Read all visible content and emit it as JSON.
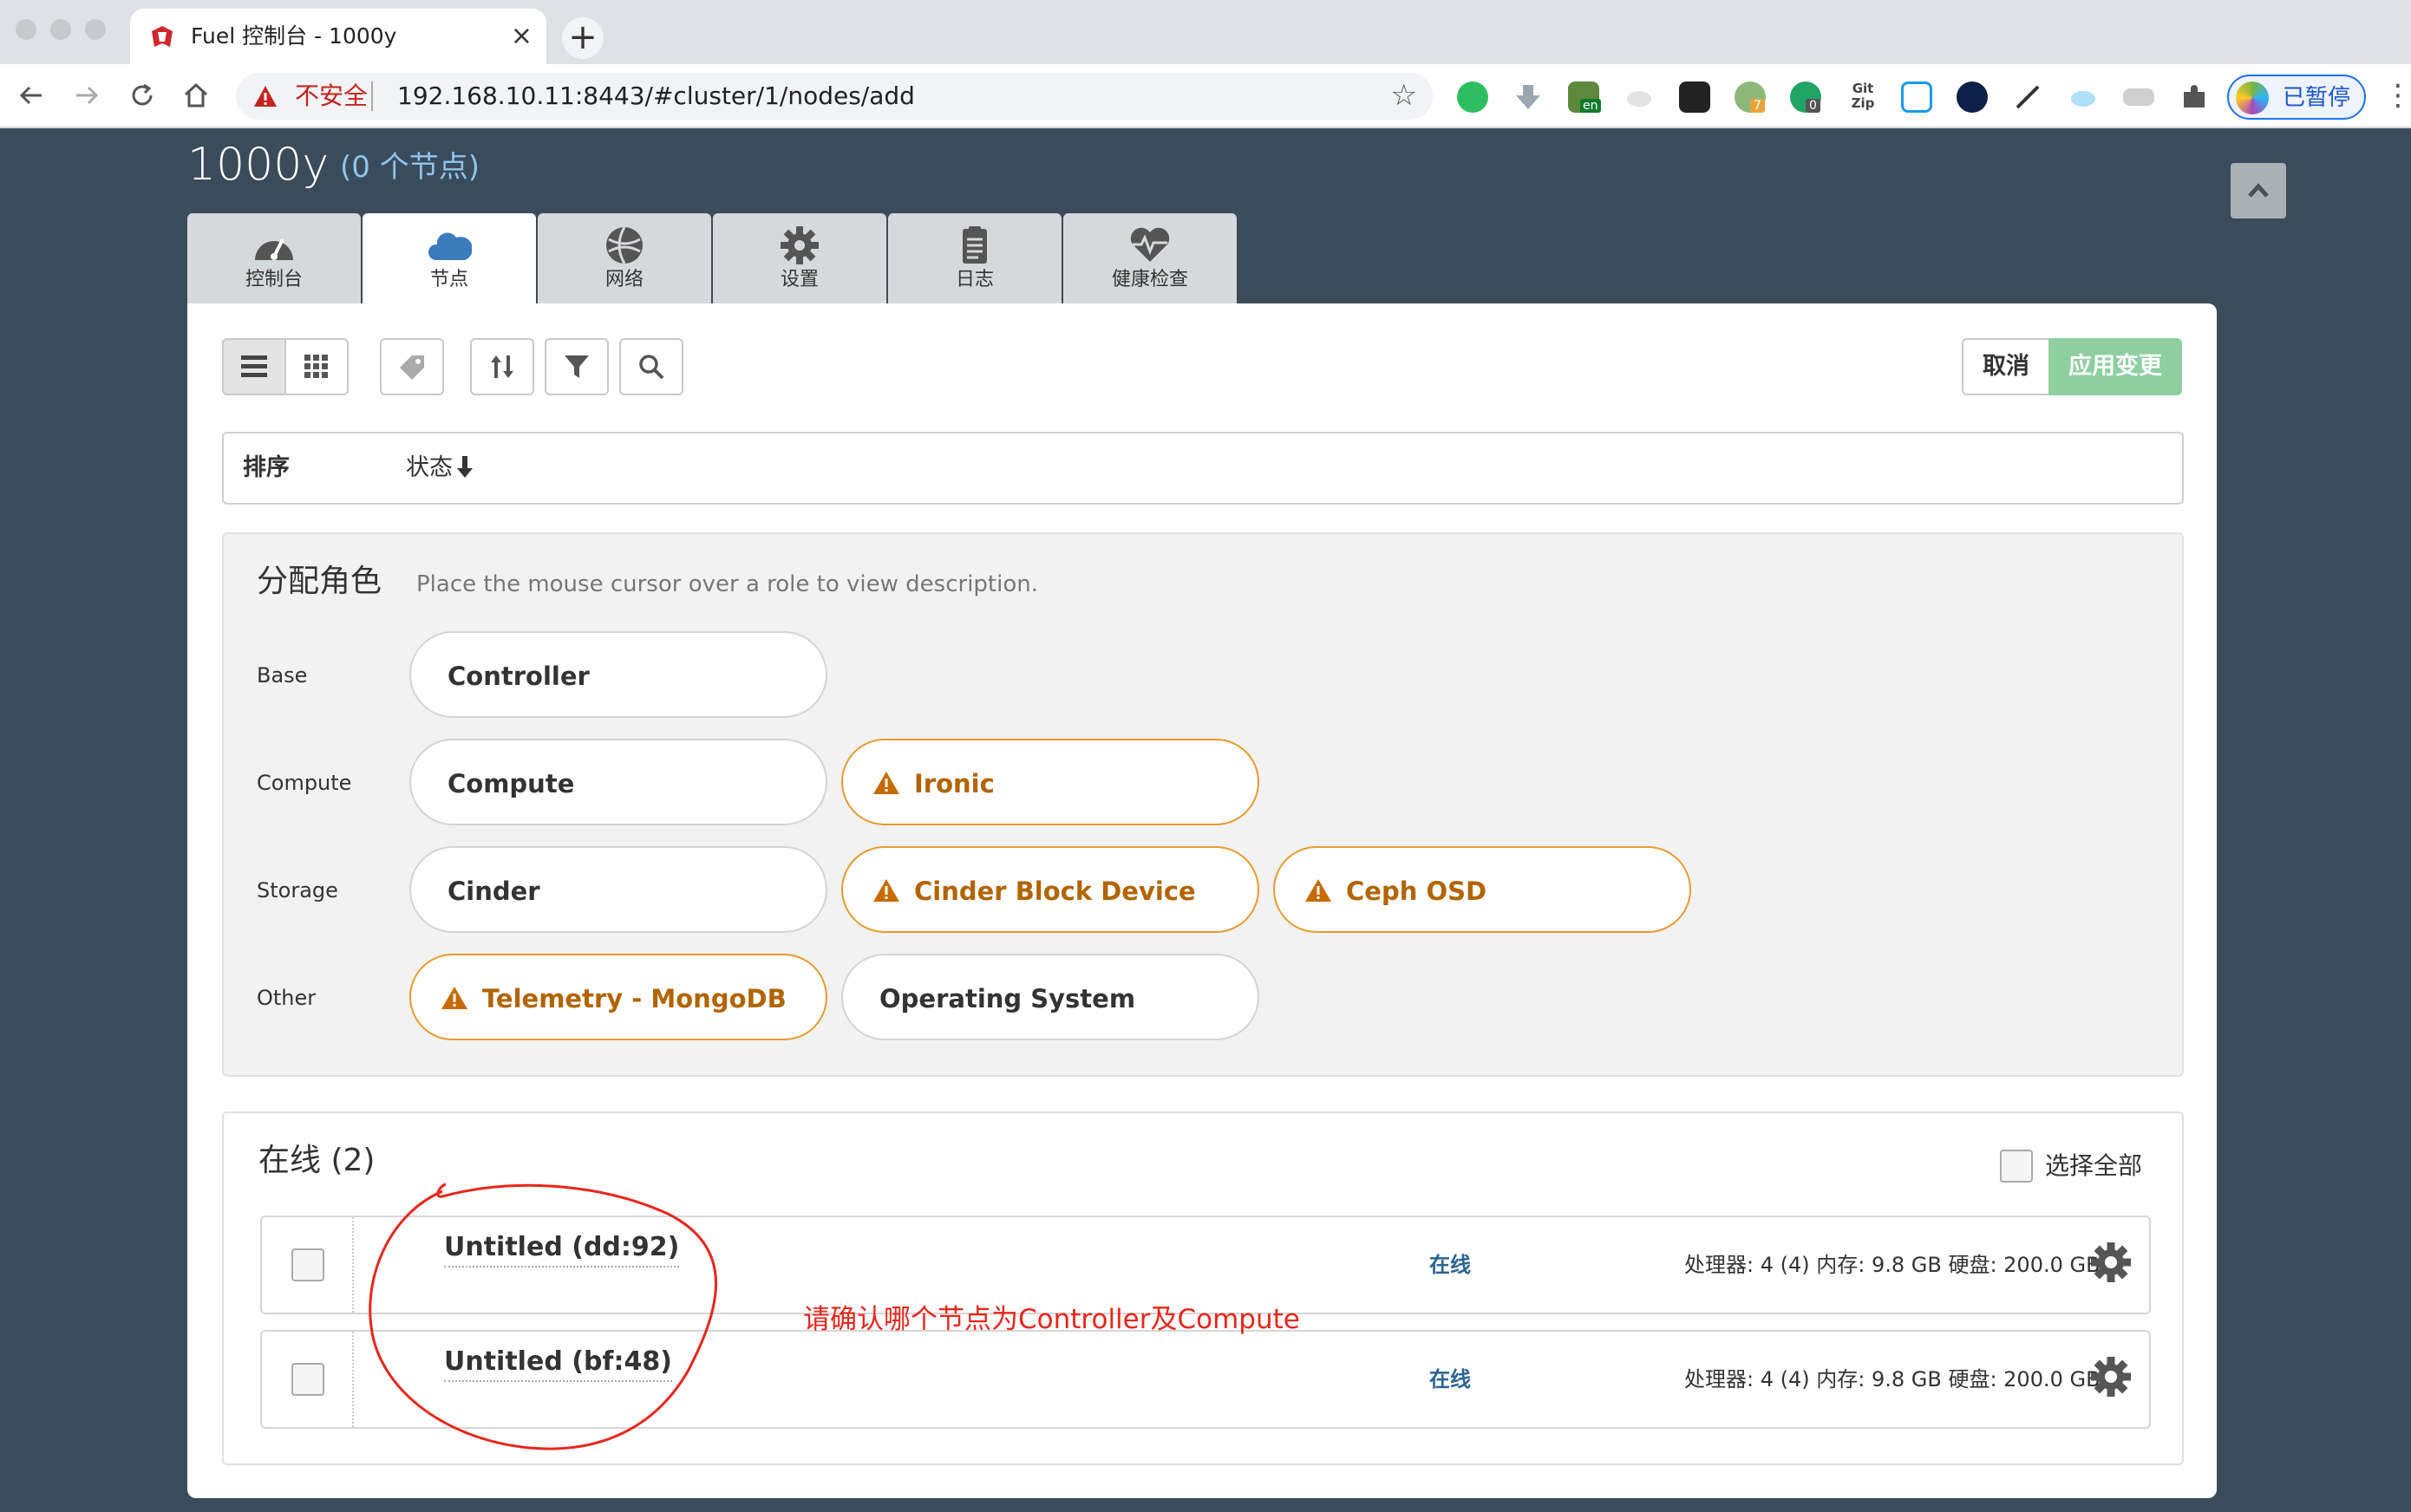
{
  "browser": {
    "tab_title": "Fuel 控制台 - 1000y",
    "tab_close": "×",
    "new_tab": "+",
    "security_label": "不安全",
    "url": "192.168.10.11:8443/#cluster/1/nodes/add",
    "bookmark_glyph": "☆",
    "profile_label": "已暂停",
    "ext_badges": {
      "en": "en",
      "seven": "7",
      "zero": "0",
      "gitzip": "Git Zip"
    },
    "colors": {
      "insecure": "#c5221f",
      "profile_border": "#1a73e8"
    }
  },
  "header": {
    "env_name": "1000y",
    "node_count": "(0 个节点)"
  },
  "tabs": [
    {
      "label": "控制台",
      "icon": "dashboard-icon"
    },
    {
      "label": "节点",
      "icon": "cloud-icon"
    },
    {
      "label": "网络",
      "icon": "network-globe-icon"
    },
    {
      "label": "设置",
      "icon": "gear-icon"
    },
    {
      "label": "日志",
      "icon": "clipboard-icon"
    },
    {
      "label": "健康检查",
      "icon": "heart-pulse-icon"
    }
  ],
  "toolbar": {
    "cancel_label": "取消",
    "apply_label": "应用变更",
    "colors": {
      "apply_bg": "#8ecf9f"
    }
  },
  "sort": {
    "label": "排序",
    "item": "状态"
  },
  "roles": {
    "title": "分配角色",
    "hint": "Place the mouse cursor over a role to view description.",
    "groups": [
      {
        "label": "Base",
        "items": [
          "Controller"
        ]
      },
      {
        "label": "Compute",
        "items": [
          "Compute",
          "Ironic"
        ]
      },
      {
        "label": "Storage",
        "items": [
          "Cinder",
          "Cinder Block Device",
          "Ceph OSD"
        ]
      },
      {
        "label": "Other",
        "items": [
          "Telemetry - MongoDB",
          "Operating System"
        ]
      }
    ],
    "colors": {
      "warning": "#b26400",
      "warning_border": "#e99a2c"
    }
  },
  "nodes": {
    "title": "在线 (2)",
    "select_all_label": "选择全部",
    "rows": [
      {
        "name": "Untitled (dd:92)",
        "status": "在线",
        "specs": "处理器: 4 (4)  内存: 9.8 GB  硬盘: 200.0 GB"
      },
      {
        "name": "Untitled (bf:48)",
        "status": "在线",
        "specs": "处理器: 4 (4)  内存: 9.8 GB  硬盘: 200.0 GB"
      }
    ],
    "colors": {
      "status": "#2a6496"
    }
  },
  "annotation": {
    "text": "请确认哪个节点为Controller及Compute",
    "color": "#e8261b"
  }
}
